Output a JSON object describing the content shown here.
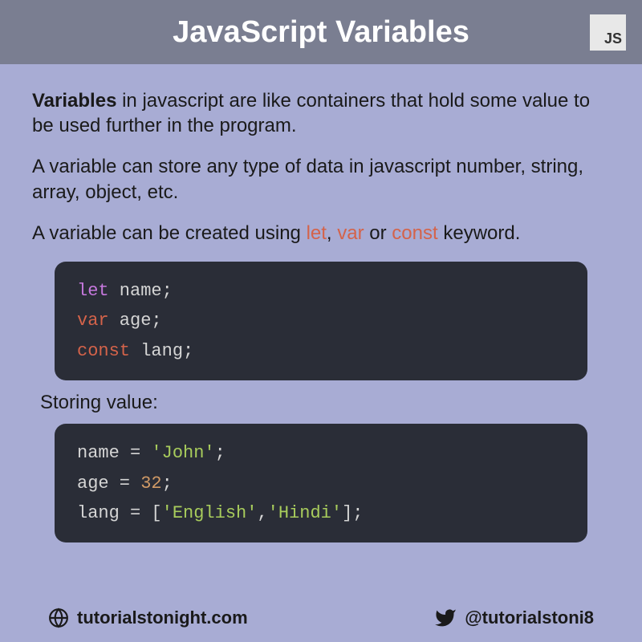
{
  "header": {
    "title": "JavaScript Variables",
    "badge": "JS"
  },
  "content": {
    "para1_bold": "Variables",
    "para1_rest": " in javascript are like containers that hold some value to be used further in the program.",
    "para2": "A variable can store any type of data in javascript number, string, array, object, etc.",
    "para3_pre": "A variable can be created using ",
    "para3_kw1": "let",
    "para3_mid1": ", ",
    "para3_kw2": "var",
    "para3_mid2": " or ",
    "para3_kw3": "const",
    "para3_post": " keyword.",
    "code1": {
      "line1_kw": "let",
      "line1_var": " name",
      "line1_end": ";",
      "line2_kw": "var",
      "line2_var": " age",
      "line2_end": ";",
      "line3_kw": "const",
      "line3_var": " lang",
      "line3_end": ";"
    },
    "subheading": "Storing value:",
    "code2": {
      "line1_var": "name = ",
      "line1_str": "'John'",
      "line1_end": ";",
      "line2_var": "age = ",
      "line2_num": "32",
      "line2_end": ";",
      "line3_var": "lang = [",
      "line3_str1": "'English'",
      "line3_mid": ",",
      "line3_str2": "'Hindi'",
      "line3_end": "];"
    }
  },
  "footer": {
    "website": "tutorialstonight.com",
    "twitter": "@tutorialstoni8"
  }
}
